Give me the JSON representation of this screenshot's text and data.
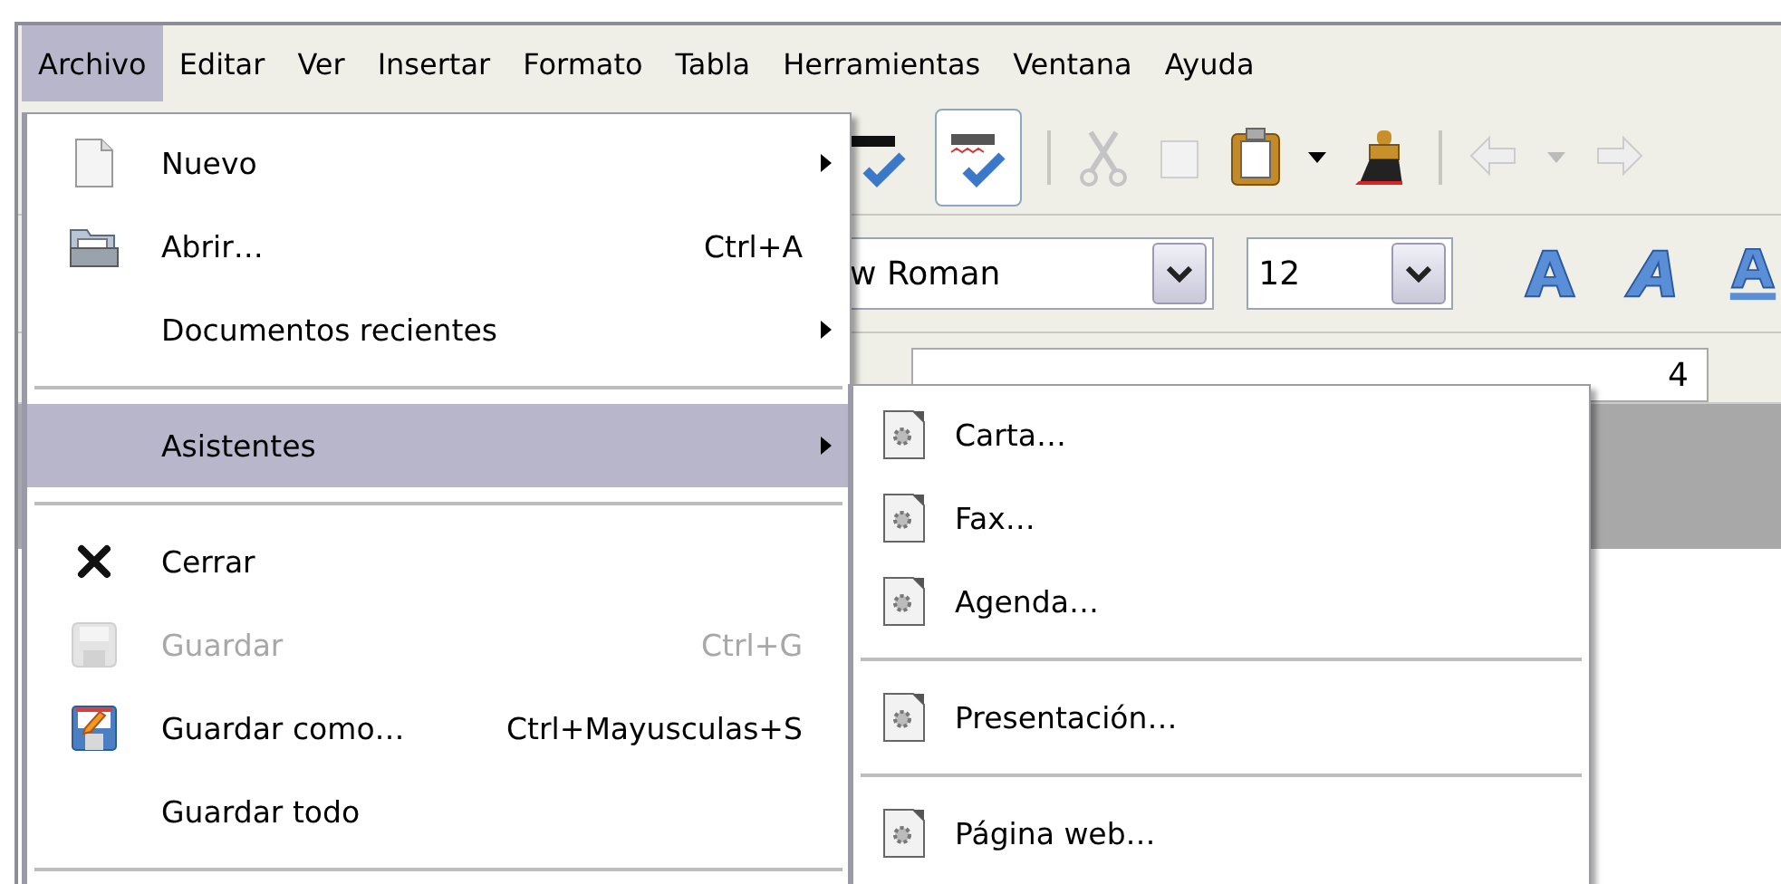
{
  "menubar": [
    {
      "label": "Archivo",
      "selected": true
    },
    {
      "label": "Editar",
      "selected": false
    },
    {
      "label": "Ver",
      "selected": false
    },
    {
      "label": "Insertar",
      "selected": false
    },
    {
      "label": "Formato",
      "selected": false
    },
    {
      "label": "Tabla",
      "selected": false
    },
    {
      "label": "Herramientas",
      "selected": false
    },
    {
      "label": "Ventana",
      "selected": false
    },
    {
      "label": "Ayuda",
      "selected": false
    }
  ],
  "formatting": {
    "font_name": "w Roman",
    "font_size": "12"
  },
  "ruler": {
    "label": "4"
  },
  "file_menu": {
    "items": [
      {
        "kind": "item",
        "label": "Nuevo",
        "submenu": true,
        "disabled": false,
        "selected": false
      },
      {
        "kind": "item",
        "label": "Abrir…",
        "shortcut": "Ctrl+A",
        "submenu": false,
        "disabled": false,
        "selected": false
      },
      {
        "kind": "item",
        "label": "Documentos recientes",
        "submenu": true,
        "disabled": false,
        "selected": false
      },
      {
        "kind": "separator"
      },
      {
        "kind": "item",
        "label": "Asistentes",
        "submenu": true,
        "disabled": false,
        "selected": true
      },
      {
        "kind": "separator"
      },
      {
        "kind": "item",
        "label": "Cerrar",
        "submenu": false,
        "disabled": false,
        "selected": false
      },
      {
        "kind": "item",
        "label": "Guardar",
        "shortcut": "Ctrl+G",
        "submenu": false,
        "disabled": true,
        "selected": false
      },
      {
        "kind": "item",
        "label": "Guardar como…",
        "shortcut": "Ctrl+Mayusculas+S",
        "submenu": false,
        "disabled": false,
        "selected": false
      },
      {
        "kind": "item",
        "label": "Guardar todo",
        "submenu": false,
        "disabled": false,
        "selected": false
      },
      {
        "kind": "separator"
      }
    ]
  },
  "wizards_menu": {
    "items": [
      {
        "kind": "item",
        "label": "Carta…",
        "selected": false
      },
      {
        "kind": "item",
        "label": "Fax…",
        "selected": false
      },
      {
        "kind": "item",
        "label": "Agenda…",
        "selected": false
      },
      {
        "kind": "separator"
      },
      {
        "kind": "item",
        "label": "Presentación…",
        "selected": false
      },
      {
        "kind": "separator"
      },
      {
        "kind": "item",
        "label": "Página web…",
        "selected": false
      }
    ]
  }
}
